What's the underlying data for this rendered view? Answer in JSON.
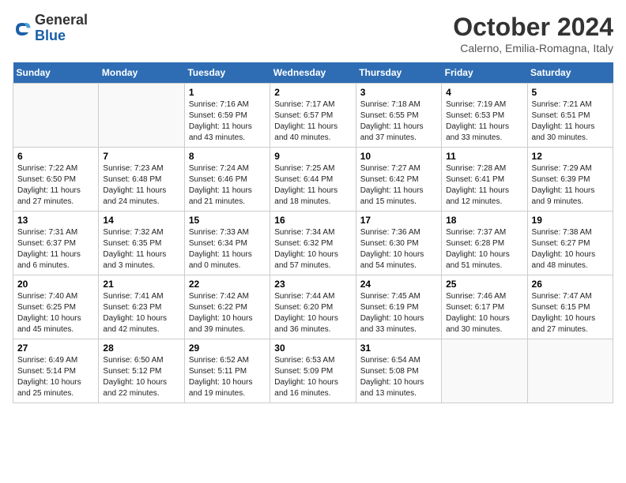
{
  "header": {
    "logo_general": "General",
    "logo_blue": "Blue",
    "month_title": "October 2024",
    "location": "Calerno, Emilia-Romagna, Italy"
  },
  "days_of_week": [
    "Sunday",
    "Monday",
    "Tuesday",
    "Wednesday",
    "Thursday",
    "Friday",
    "Saturday"
  ],
  "weeks": [
    [
      {
        "num": "",
        "detail": ""
      },
      {
        "num": "",
        "detail": ""
      },
      {
        "num": "1",
        "detail": "Sunrise: 7:16 AM\nSunset: 6:59 PM\nDaylight: 11 hours and 43 minutes."
      },
      {
        "num": "2",
        "detail": "Sunrise: 7:17 AM\nSunset: 6:57 PM\nDaylight: 11 hours and 40 minutes."
      },
      {
        "num": "3",
        "detail": "Sunrise: 7:18 AM\nSunset: 6:55 PM\nDaylight: 11 hours and 37 minutes."
      },
      {
        "num": "4",
        "detail": "Sunrise: 7:19 AM\nSunset: 6:53 PM\nDaylight: 11 hours and 33 minutes."
      },
      {
        "num": "5",
        "detail": "Sunrise: 7:21 AM\nSunset: 6:51 PM\nDaylight: 11 hours and 30 minutes."
      }
    ],
    [
      {
        "num": "6",
        "detail": "Sunrise: 7:22 AM\nSunset: 6:50 PM\nDaylight: 11 hours and 27 minutes."
      },
      {
        "num": "7",
        "detail": "Sunrise: 7:23 AM\nSunset: 6:48 PM\nDaylight: 11 hours and 24 minutes."
      },
      {
        "num": "8",
        "detail": "Sunrise: 7:24 AM\nSunset: 6:46 PM\nDaylight: 11 hours and 21 minutes."
      },
      {
        "num": "9",
        "detail": "Sunrise: 7:25 AM\nSunset: 6:44 PM\nDaylight: 11 hours and 18 minutes."
      },
      {
        "num": "10",
        "detail": "Sunrise: 7:27 AM\nSunset: 6:42 PM\nDaylight: 11 hours and 15 minutes."
      },
      {
        "num": "11",
        "detail": "Sunrise: 7:28 AM\nSunset: 6:41 PM\nDaylight: 11 hours and 12 minutes."
      },
      {
        "num": "12",
        "detail": "Sunrise: 7:29 AM\nSunset: 6:39 PM\nDaylight: 11 hours and 9 minutes."
      }
    ],
    [
      {
        "num": "13",
        "detail": "Sunrise: 7:31 AM\nSunset: 6:37 PM\nDaylight: 11 hours and 6 minutes."
      },
      {
        "num": "14",
        "detail": "Sunrise: 7:32 AM\nSunset: 6:35 PM\nDaylight: 11 hours and 3 minutes."
      },
      {
        "num": "15",
        "detail": "Sunrise: 7:33 AM\nSunset: 6:34 PM\nDaylight: 11 hours and 0 minutes."
      },
      {
        "num": "16",
        "detail": "Sunrise: 7:34 AM\nSunset: 6:32 PM\nDaylight: 10 hours and 57 minutes."
      },
      {
        "num": "17",
        "detail": "Sunrise: 7:36 AM\nSunset: 6:30 PM\nDaylight: 10 hours and 54 minutes."
      },
      {
        "num": "18",
        "detail": "Sunrise: 7:37 AM\nSunset: 6:28 PM\nDaylight: 10 hours and 51 minutes."
      },
      {
        "num": "19",
        "detail": "Sunrise: 7:38 AM\nSunset: 6:27 PM\nDaylight: 10 hours and 48 minutes."
      }
    ],
    [
      {
        "num": "20",
        "detail": "Sunrise: 7:40 AM\nSunset: 6:25 PM\nDaylight: 10 hours and 45 minutes."
      },
      {
        "num": "21",
        "detail": "Sunrise: 7:41 AM\nSunset: 6:23 PM\nDaylight: 10 hours and 42 minutes."
      },
      {
        "num": "22",
        "detail": "Sunrise: 7:42 AM\nSunset: 6:22 PM\nDaylight: 10 hours and 39 minutes."
      },
      {
        "num": "23",
        "detail": "Sunrise: 7:44 AM\nSunset: 6:20 PM\nDaylight: 10 hours and 36 minutes."
      },
      {
        "num": "24",
        "detail": "Sunrise: 7:45 AM\nSunset: 6:19 PM\nDaylight: 10 hours and 33 minutes."
      },
      {
        "num": "25",
        "detail": "Sunrise: 7:46 AM\nSunset: 6:17 PM\nDaylight: 10 hours and 30 minutes."
      },
      {
        "num": "26",
        "detail": "Sunrise: 7:47 AM\nSunset: 6:15 PM\nDaylight: 10 hours and 27 minutes."
      }
    ],
    [
      {
        "num": "27",
        "detail": "Sunrise: 6:49 AM\nSunset: 5:14 PM\nDaylight: 10 hours and 25 minutes."
      },
      {
        "num": "28",
        "detail": "Sunrise: 6:50 AM\nSunset: 5:12 PM\nDaylight: 10 hours and 22 minutes."
      },
      {
        "num": "29",
        "detail": "Sunrise: 6:52 AM\nSunset: 5:11 PM\nDaylight: 10 hours and 19 minutes."
      },
      {
        "num": "30",
        "detail": "Sunrise: 6:53 AM\nSunset: 5:09 PM\nDaylight: 10 hours and 16 minutes."
      },
      {
        "num": "31",
        "detail": "Sunrise: 6:54 AM\nSunset: 5:08 PM\nDaylight: 10 hours and 13 minutes."
      },
      {
        "num": "",
        "detail": ""
      },
      {
        "num": "",
        "detail": ""
      }
    ]
  ]
}
